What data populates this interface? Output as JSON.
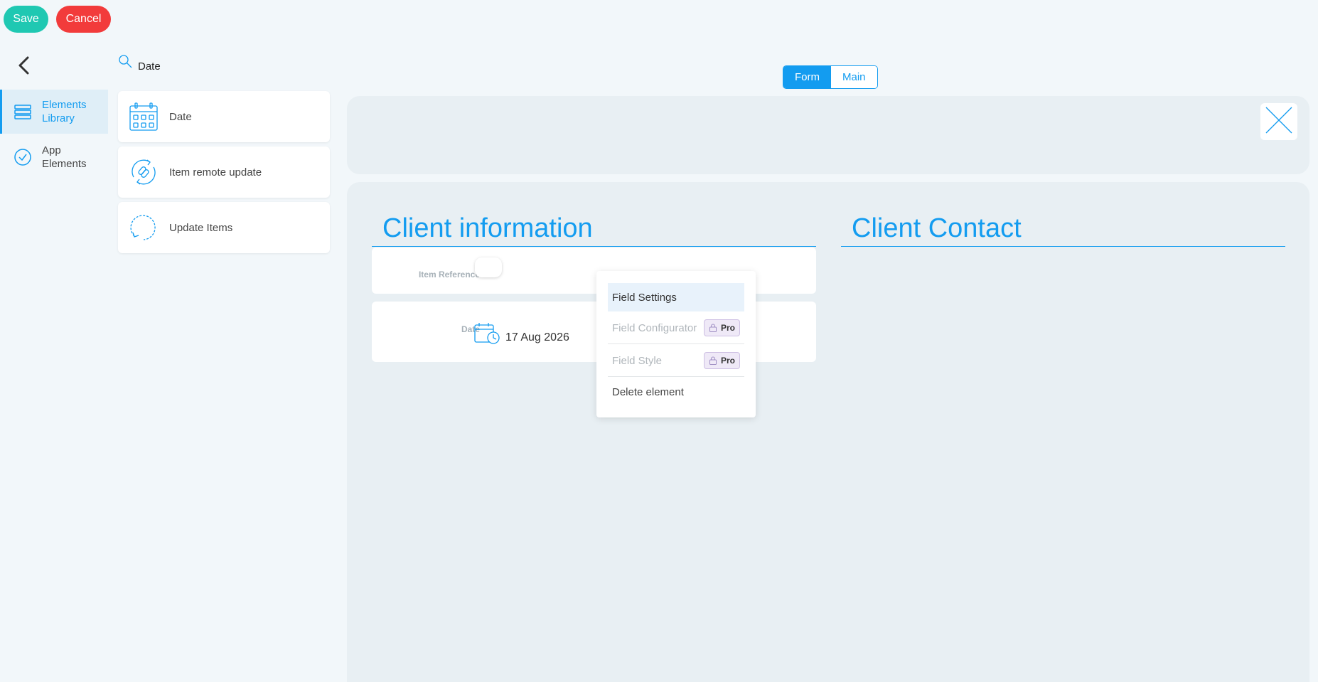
{
  "toolbar": {
    "save_label": "Save",
    "cancel_label": "Cancel"
  },
  "nav": {
    "items": [
      {
        "label_line1": "Elements",
        "label_line2": "Library",
        "icon": "stack-icon",
        "active": true
      },
      {
        "label_line1": "App",
        "label_line2": "Elements",
        "icon": "check-circle-icon",
        "active": false
      }
    ]
  },
  "search": {
    "value": "Date",
    "icon": "search-icon"
  },
  "library": {
    "items": [
      {
        "label": "Date",
        "icon": "calendar-icon"
      },
      {
        "label": "Item remote update",
        "icon": "link-refresh-icon"
      },
      {
        "label": "Update Items",
        "icon": "refresh-icon"
      }
    ]
  },
  "tabs": [
    {
      "label": "Form",
      "active": true
    },
    {
      "label": "Main",
      "active": false
    }
  ],
  "sections": [
    {
      "title": "Client information"
    },
    {
      "title": "Client Contact"
    }
  ],
  "fields": [
    {
      "label": "Item Reference",
      "type": "toggle"
    },
    {
      "label": "Date",
      "value": "17 Aug 2026",
      "icon": "calendar-clock-icon"
    }
  ],
  "context_menu": {
    "items": [
      {
        "label": "Field Settings",
        "badge": ""
      },
      {
        "label": "Field Configurator",
        "badge": "Pro"
      },
      {
        "label": "Field Style",
        "badge": "Pro"
      },
      {
        "label": "Delete element",
        "badge": ""
      }
    ]
  },
  "colors": {
    "accent": "#139cf0",
    "save": "#1fc8b2",
    "cancel": "#f23b3b",
    "background": "#f2f7fa",
    "panel": "#e8eff3"
  }
}
